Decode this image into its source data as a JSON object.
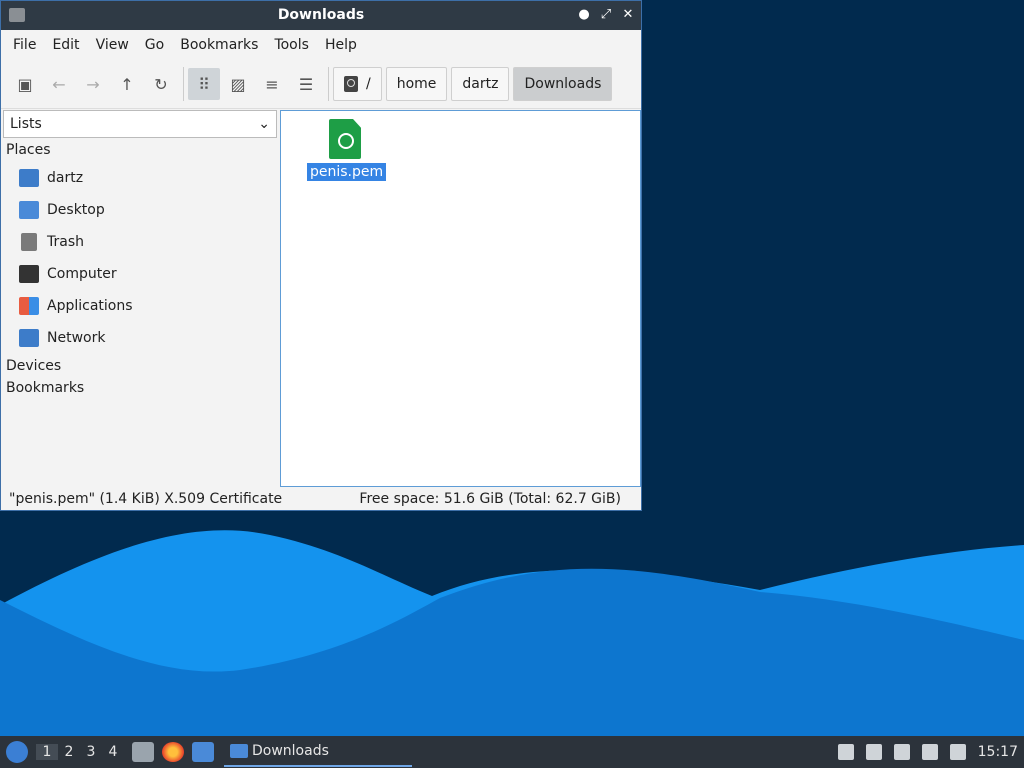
{
  "window": {
    "title": "Downloads",
    "controls": [
      "minimize-icon",
      "maximize-icon",
      "close-icon"
    ]
  },
  "menu": [
    "File",
    "Edit",
    "View",
    "Go",
    "Bookmarks",
    "Tools",
    "Help"
  ],
  "toolbar": {
    "path": [
      "/",
      "home",
      "dartz",
      "Downloads"
    ]
  },
  "sidebar": {
    "selector": "Lists",
    "places_label": "Places",
    "places": [
      "dartz",
      "Desktop",
      "Trash",
      "Computer",
      "Applications",
      "Network"
    ],
    "devices_label": "Devices",
    "bookmarks_label": "Bookmarks"
  },
  "files": [
    {
      "name": "penis.pem",
      "selected": true
    }
  ],
  "status": {
    "left": "\"penis.pem\" (1.4 KiB) X.509 Certificate",
    "right": "Free space: 51.6 GiB (Total: 62.7 GiB)"
  },
  "taskbar": {
    "workspaces": [
      "1",
      "2",
      "3",
      "4"
    ],
    "active_window": "Downloads",
    "clock": "15:17"
  },
  "colors": {
    "desktop_bg": "#012a4e",
    "wave_light": "#1493ee",
    "wave_dark": "#0d76cf",
    "selection": "#3584e4"
  }
}
